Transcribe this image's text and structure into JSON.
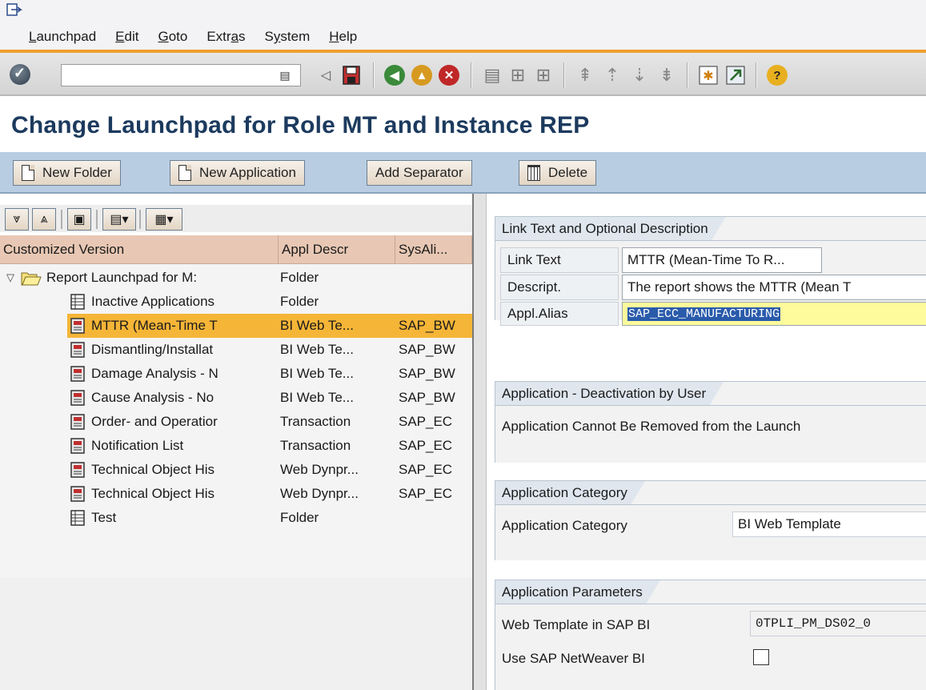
{
  "menu": {
    "items": [
      {
        "label": "Launchpad",
        "key": "L",
        "rest": "aunchpad"
      },
      {
        "label": "Edit",
        "key": "E",
        "rest": "dit"
      },
      {
        "label": "Goto",
        "key": "G",
        "rest": "oto"
      },
      {
        "label": "Extras",
        "key_pre": "Extr",
        "key": "a",
        "rest": "s"
      },
      {
        "label": "System",
        "key_pre": "S",
        "key": "y",
        "rest": "stem"
      },
      {
        "label": "Help",
        "key": "H",
        "rest": "elp"
      }
    ]
  },
  "toolbar": {
    "command_value": "",
    "icons": [
      "enter-icon",
      "back-arrow-icon",
      "save-icon",
      "back-icon",
      "exit-icon",
      "cancel-icon",
      "print-icon",
      "find-icon",
      "find-next-icon",
      "first-page-icon",
      "prev-page-icon",
      "next-page-icon",
      "last-page-icon",
      "new-session-icon",
      "shortcut-icon",
      "help-icon"
    ]
  },
  "title": "Change Launchpad for Role MT and Instance REP",
  "app_toolbar": {
    "new_folder": "New Folder",
    "new_application": "New Application",
    "add_separator": "Add Separator",
    "delete": "Delete"
  },
  "tree": {
    "headers": [
      "Customized Version",
      "Appl Descr",
      "SysAli..."
    ],
    "root": {
      "text": "Report Launchpad for M:",
      "descr": "Folder",
      "alias": ""
    },
    "rows": [
      {
        "text": "Inactive Applications",
        "descr": "Folder",
        "alias": "",
        "icon": "folder-table-icon"
      },
      {
        "text": "MTTR (Mean-Time T",
        "descr": "BI Web Te...",
        "alias": "SAP_BW",
        "icon": "report-icon",
        "selected": true
      },
      {
        "text": "Dismantling/Installat",
        "descr": "BI Web Te...",
        "alias": "SAP_BW",
        "icon": "report-icon"
      },
      {
        "text": "Damage Analysis - N",
        "descr": "BI Web Te...",
        "alias": "SAP_BW",
        "icon": "report-icon"
      },
      {
        "text": "Cause Analysis - No",
        "descr": "BI Web Te...",
        "alias": "SAP_BW",
        "icon": "report-icon"
      },
      {
        "text": "Order- and Operatior",
        "descr": "Transaction",
        "alias": "SAP_EC",
        "icon": "report-icon"
      },
      {
        "text": "Notification List",
        "descr": "Transaction",
        "alias": "SAP_EC",
        "icon": "report-icon"
      },
      {
        "text": "Technical Object His",
        "descr": "Web Dynpr...",
        "alias": "SAP_EC",
        "icon": "report-icon"
      },
      {
        "text": "Technical Object His",
        "descr": "Web Dynpr...",
        "alias": "SAP_EC",
        "icon": "report-icon"
      },
      {
        "text": "Test",
        "descr": "Folder",
        "alias": "",
        "icon": "folder-table-icon"
      }
    ]
  },
  "link_group": {
    "title": "Link Text and Optional Description",
    "link_text_label": "Link Text",
    "link_text_value": "MTTR (Mean-Time To R...",
    "descript_label": "Descript.",
    "descript_value": "The report shows the MTTR (Mean T",
    "alias_label": "Appl.Alias",
    "alias_value": "SAP_ECC_MANUFACTURING"
  },
  "deact_group": {
    "title": "Application - Deactivation by User",
    "text": "Application Cannot Be Removed from the Launch"
  },
  "category_group": {
    "title": "Application Category",
    "label": "Application Category",
    "value": "BI Web Template"
  },
  "params_group": {
    "title": "Application Parameters",
    "template_label": "Web Template in SAP BI",
    "template_value": "0TPLI_PM_DS02_0",
    "netweaver_label": "Use SAP NetWeaver BI",
    "netweaver_checked": false
  },
  "colors": {
    "title": "#1c3a5e",
    "app_toolbar": "#b9cde2",
    "header_cell": "#e8c8b4",
    "selection": "#f5b537",
    "alias_field": "#fdfb9c"
  }
}
